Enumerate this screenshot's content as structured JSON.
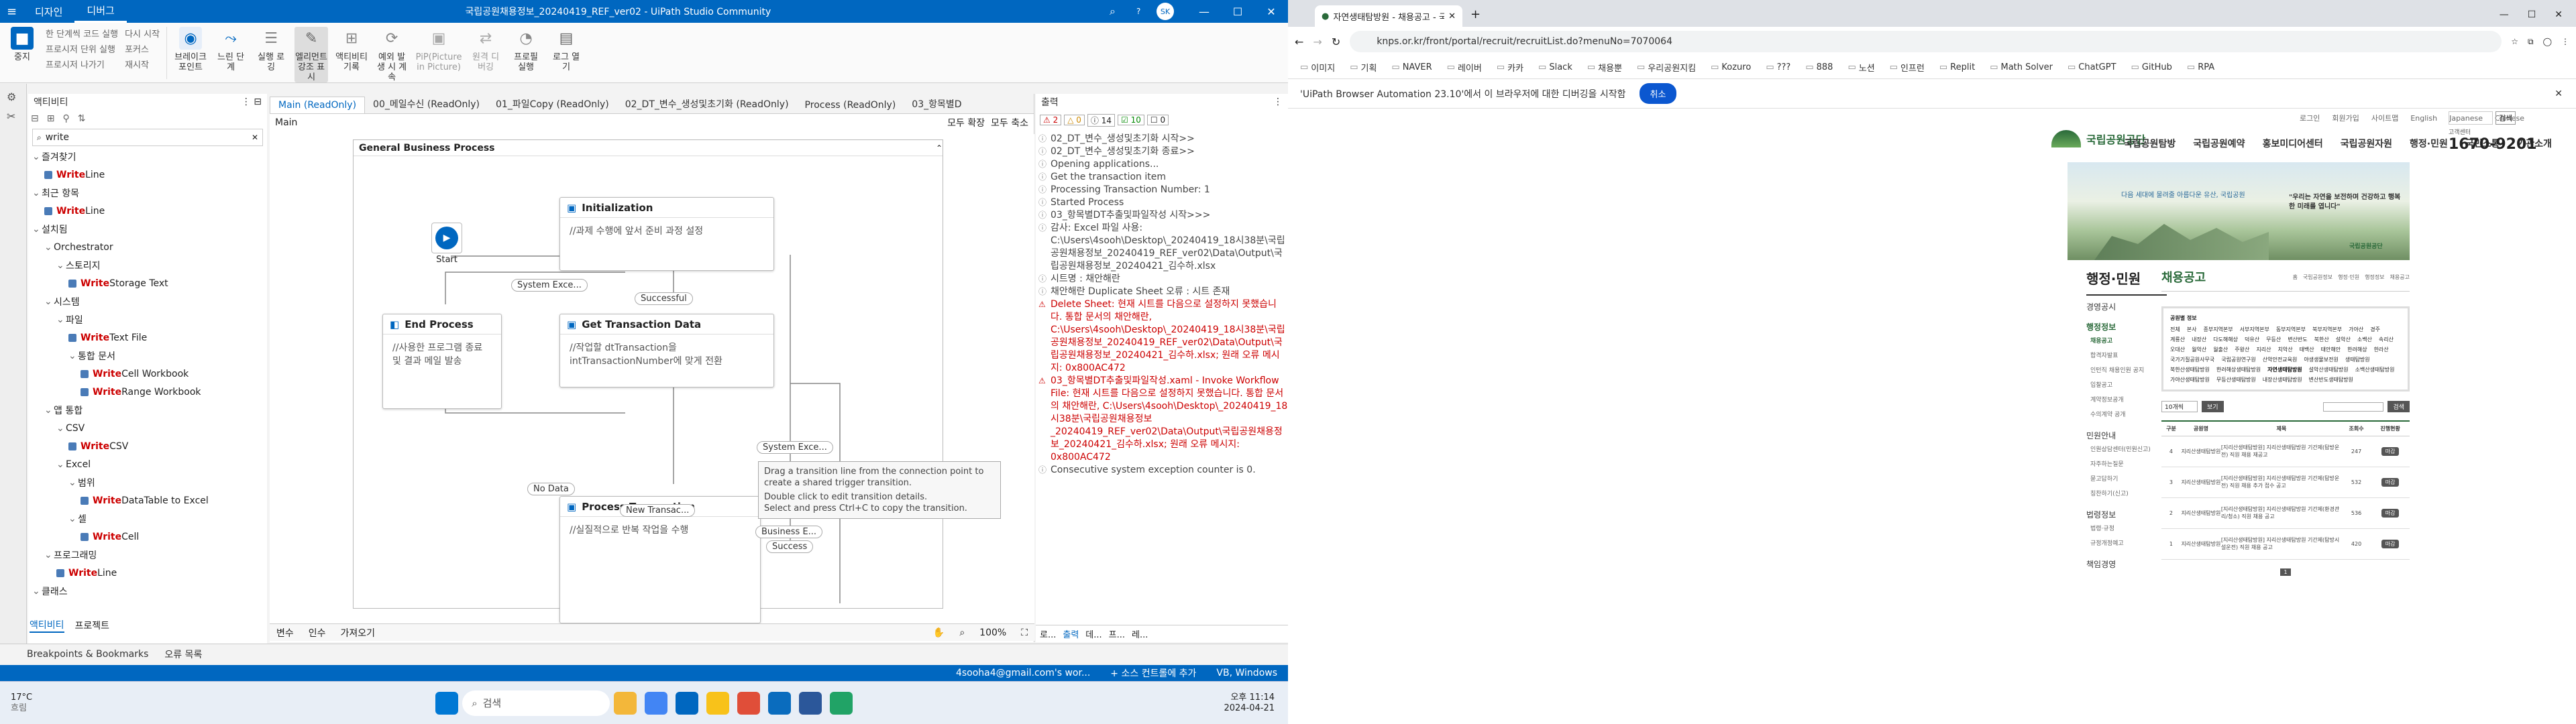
{
  "uipath": {
    "menu_tabs": [
      "디자인",
      "디버그"
    ],
    "title": "국립공원채용정보_20240419_REF_ver02 - UiPath Studio Community",
    "avatar": "SK",
    "ribbon": {
      "stop": "중지",
      "small": [
        "한 단계씩 코드 실행",
        "한 단계씩 실행",
        "프로시저 단위 실행",
        "다시 시작",
        "프로시저 나가기",
        "포커스",
        "재시작"
      ],
      "big": [
        "브레이크포인트",
        "느린 단계",
        "실행 로깅",
        "엘리먼트 강조 표시",
        "액티비티 기록",
        "예외 발생 시 계속",
        "PiP(Picture in Picture)",
        "원격 디버깅",
        "프로필 실행",
        "로그 열기"
      ]
    },
    "activities": {
      "header": "액티비티",
      "search": "write",
      "tree": [
        {
          "indent": 0,
          "text": "즐겨찾기",
          "kind": "cat"
        },
        {
          "indent": 1,
          "kw": "Write",
          "text": " Line",
          "kind": "act"
        },
        {
          "indent": 0,
          "text": "최근 항목",
          "kind": "cat"
        },
        {
          "indent": 1,
          "kw": "Write",
          "text": " Line",
          "kind": "act"
        },
        {
          "indent": 0,
          "text": "설치됨",
          "kind": "cat"
        },
        {
          "indent": 1,
          "text": "Orchestrator",
          "kind": "cat"
        },
        {
          "indent": 2,
          "text": "스토리지",
          "kind": "cat"
        },
        {
          "indent": 3,
          "kw": "Write",
          "text": " Storage Text",
          "kind": "act"
        },
        {
          "indent": 1,
          "text": "시스템",
          "kind": "cat"
        },
        {
          "indent": 2,
          "text": "파일",
          "kind": "cat"
        },
        {
          "indent": 3,
          "kw": "Write",
          "text": " Text File",
          "kind": "act"
        },
        {
          "indent": 3,
          "text": "통합 문서",
          "kind": "cat"
        },
        {
          "indent": 4,
          "kw": "Write",
          "text": " Cell Workbook",
          "kind": "act"
        },
        {
          "indent": 4,
          "kw": "Write",
          "text": " Range Workbook",
          "kind": "act"
        },
        {
          "indent": 1,
          "text": "앱 통합",
          "kind": "cat"
        },
        {
          "indent": 2,
          "text": "CSV",
          "kind": "cat"
        },
        {
          "indent": 3,
          "kw": "Write",
          "text": " CSV",
          "kind": "act"
        },
        {
          "indent": 2,
          "text": "Excel",
          "kind": "cat"
        },
        {
          "indent": 3,
          "text": "범위",
          "kind": "cat"
        },
        {
          "indent": 4,
          "kw": "Write",
          "text": " DataTable to Excel",
          "kind": "act"
        },
        {
          "indent": 3,
          "text": "셀",
          "kind": "cat"
        },
        {
          "indent": 4,
          "kw": "Write",
          "text": " Cell",
          "kind": "act"
        },
        {
          "indent": 1,
          "text": "프로그래밍",
          "kind": "cat"
        },
        {
          "indent": 2,
          "kw": "Write",
          "text": " Line",
          "kind": "act"
        },
        {
          "indent": 0,
          "text": "클래스",
          "kind": "cat"
        }
      ],
      "tabs": [
        "액티비티",
        "프로젝트"
      ],
      "bottom_links": [
        "Breakpoints & Bookmarks",
        "오류 목록"
      ]
    },
    "doc_tabs": [
      "Main (ReadOnly)",
      "00_메일수신 (ReadOnly)",
      "01_파일Copy (ReadOnly)",
      "02_DT_변수_생성및초기화 (ReadOnly)",
      "Process (ReadOnly)",
      "03_항목별D"
    ],
    "breadcrumb": "Main",
    "expand_all": "모두 확장",
    "collapse_all": "모두 축소",
    "flow_title": "General Business Process",
    "start": "Start",
    "states": {
      "init": {
        "title": "Initialization",
        "body": "//과제 수행에 앞서 준비 과정 설정"
      },
      "end": {
        "title": "End Process",
        "body": "//사용한 프로그램 종료 및 결과 메일 발송"
      },
      "get": {
        "title": "Get Transaction Data",
        "body": "//작업할 dtTransaction을 intTransactionNumber에 맞게 전환"
      },
      "proc": {
        "title": "Process Transaction",
        "body": "//실질적으로 반복 작업을 수행"
      }
    },
    "transitions": [
      "System Exce...",
      "Successful",
      "System Exce...",
      "No Data",
      "New Transac...",
      "Business E...",
      "Success"
    ],
    "tooltip": [
      "Drag a transition line from the connection point to create a shared trigger transition.",
      "Double click to edit transition details.",
      "Select and press Ctrl+C to copy the transition."
    ],
    "designer_bottom": {
      "vars": "변수",
      "args": "인수",
      "imports": "가져오기",
      "zoom": "100%"
    },
    "output": {
      "header": "출력",
      "counts": [
        "2",
        "0",
        "14",
        "10",
        "0"
      ],
      "lines": [
        {
          "t": "02_DT_변수_생성및초기화 시작>>",
          "e": false
        },
        {
          "t": "02_DT_변수_생성및초기화 종료>>",
          "e": false
        },
        {
          "t": "Opening applications...",
          "e": false
        },
        {
          "t": "Get the transaction item",
          "e": false
        },
        {
          "t": "Processing Transaction Number: 1",
          "e": false
        },
        {
          "t": "Started Process",
          "e": false
        },
        {
          "t": "03_항목별DT추출및파일작성 시작>>>",
          "e": false
        },
        {
          "t": "감사: Excel 파일 사용: C:\\Users\\4sooh\\Desktop\\_20240419_18시38분\\국립공원채용정보_20240419_REF_ver02\\Data\\Output\\국립공원채용정보_20240421_김수하.xlsx",
          "e": false
        },
        {
          "t": "시트명 : 채안해란",
          "e": false
        },
        {
          "t": "채안해란 Duplicate Sheet 오류 : 시트 존재",
          "e": false
        },
        {
          "t": "Delete Sheet: 현재 시트를 다음으로 설정하지 못했습니다. 통합 문서의 채안해란, C:\\Users\\4sooh\\Desktop\\_20240419_18시38분\\국립공원채용정보_20240419_REF_ver02\\Data\\Output\\국립공원채용정보_20240421_김수하.xlsx; 원래 오류 메시지: 0x800AC472",
          "e": true
        },
        {
          "t": "03_항목별DT추출및파일작성.xaml - Invoke Workflow File: 현재 시트를 다음으로 설정하지 못했습니다. 통합 문서의 채안해란, C:\\Users\\4sooh\\Desktop\\_20240419_18시38분\\국립공원채용정보_20240419_REF_ver02\\Data\\Output\\국립공원채용정보_20240421_김수하.xlsx; 원래 오류 메시지: 0x800AC472",
          "e": true
        },
        {
          "t": "Consecutive system exception counter is 0.",
          "e": false
        }
      ],
      "bottom_tabs": [
        "로...",
        "출력",
        "데...",
        "프...",
        "레..."
      ]
    },
    "status": {
      "user": "4sooha4@gmail.com's wor...",
      "source": "+ 소스 컨트롤에 추가",
      "platform": "VB, Windows"
    }
  },
  "taskbar": {
    "weather_temp": "17°C",
    "weather_text": "흐림",
    "search": "검색",
    "time": "오후 11:14",
    "date": "2024-04-21"
  },
  "chrome": {
    "tab_title": "자연생태탐방원 - 채용공고 - 국",
    "url": "knps.or.kr/front/portal/recruit/recruitList.do?menuNo=7070064",
    "bookmarks": [
      "이미지",
      "기획",
      "NAVER",
      "레이버",
      "카카",
      "Slack",
      "채용뿐",
      "우리공원지킴",
      "Kozuro",
      "???",
      "888",
      "노션",
      "인프런",
      "Replit",
      "Math Solver",
      "ChatGPT",
      "GitHub",
      "RPA"
    ],
    "infobar": "'UiPath Browser Automation 23.10'에서 이 브라우저에 대한 디버깅을 시작함",
    "infobar_btn": "취소",
    "site": {
      "top_links": [
        "로그인",
        "회원가입",
        "사이트맵",
        "English",
        "Japanese",
        "Chinese"
      ],
      "search_btn": "검색",
      "logo": "국립공원공단",
      "gnb": [
        "국립공원탐방",
        "국립공원예약",
        "홍보미디어센터",
        "국립공원자원",
        "행정·민원",
        "국민소통",
        "기관소개"
      ],
      "phone_label": "고객센터",
      "phone": "1670-9201",
      "banner_slogan": "다음 세대에 물려줄 아름다운 유산, 국립공원",
      "banner_quote": "\"우리는 자연을 보전하며 건강하고 행복한 미래를 엽니다\"",
      "banner_logo": "국립공원공단",
      "side_title": "행정·민원",
      "side_nav": [
        "경영공시",
        "행정정보",
        "채용공고",
        "합격자발표",
        "인턴직 채용인원 공지",
        "입찰공고",
        "계약정보공개",
        "수의계약 공개",
        "민원안내",
        "인원상담센터(민원신고)",
        "자주하는질문",
        "묻고답하기",
        "칭찬하기(신고)",
        "법령정보",
        "법령·규정",
        "규정개정예고",
        "책임경영"
      ],
      "page_title": "채용공고",
      "crumbs": [
        "홈",
        "국립공원정보",
        "행정·민원",
        "행정정보",
        "채용공고"
      ],
      "filter_title": "공원별 정보",
      "parks": [
        "전체",
        "본사",
        "종부지역본부",
        "서부지역본부",
        "동부지역본부",
        "북부지역본부",
        "가야산",
        "경주",
        "계룡산",
        "내장산",
        "다도해해상",
        "덕유산",
        "무등산",
        "변산반도",
        "북한산",
        "설악산",
        "소백산",
        "속리산",
        "오대산",
        "월악산",
        "월출산",
        "주왕산",
        "지리산",
        "치악산",
        "태백산",
        "태안해안",
        "한려해상",
        "한라산",
        "국가기질공원사무국",
        "국립공원연구원",
        "산악안전교육원",
        "야생생물보전원",
        "생태탐방원",
        "북한산생태탐방원",
        "한려해상생태탐방원",
        "자연생태탐방원",
        "설악산생태탐방원",
        "소백산생태탐방원",
        "가야산생태탐방원",
        "무등산생태탐방원",
        "내장산생태탐방원",
        "변산반도생태탐방원"
      ],
      "per_page": "10개씩",
      "view_btn": "보기",
      "search_btn2": "검색",
      "columns": [
        "구분",
        "공원명",
        "제목",
        "조회수",
        "진행현황"
      ],
      "rows": [
        {
          "n": "4",
          "park": "지리산생태탐방원",
          "title": "[지리산생태탐방원] 지리산생태탐방원 기간제(탐방운전) 직원 채용 재공고",
          "views": "247",
          "status": "마감"
        },
        {
          "n": "3",
          "park": "지리산생태탐방원",
          "title": "[지리산생태탐방원] 지리산생태탐방원 기간제(탐방운전) 직원 채용 추가 접수 공고",
          "views": "532",
          "status": "마감"
        },
        {
          "n": "2",
          "park": "지리산생태탐방원",
          "title": "[지리산생태탐방원] 지리산생태탐방원 기간제(환경관리/청소) 직원 채용 공고",
          "views": "536",
          "status": "마감"
        },
        {
          "n": "1",
          "park": "지리산생태탐방원",
          "title": "[지리산생태탐방원] 지리산생태탐방원 기간제(탐방시설운전) 직원 채용 공고",
          "views": "420",
          "status": "마감"
        }
      ],
      "page": "1"
    }
  }
}
